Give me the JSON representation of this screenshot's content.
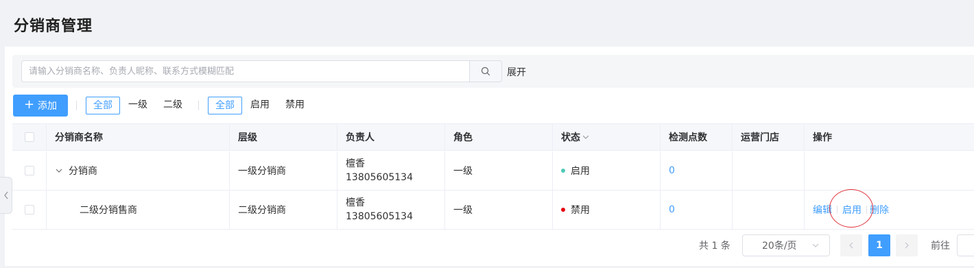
{
  "page": {
    "title": "分销商管理"
  },
  "search": {
    "placeholder": "请输入分销商名称、负责人昵称、联系方式模糊匹配",
    "value": "",
    "expand_label": "展开",
    "icon": "search-icon"
  },
  "toolbar": {
    "add_label": "添加",
    "level_filters": [
      "全部",
      "一级",
      "二级"
    ],
    "level_active": "全部",
    "status_filters": [
      "全部",
      "启用",
      "禁用"
    ],
    "status_active": "全部"
  },
  "table": {
    "columns": [
      "",
      "分销商名称",
      "层级",
      "负责人",
      "角色",
      "状态",
      "检测点数",
      "运营门店",
      "操作"
    ],
    "rows": [
      {
        "name": "分销商",
        "expandable": true,
        "level": "一级分销商",
        "owner_name": "檀香",
        "owner_phone": "13805605134",
        "role": "一级",
        "status": "启用",
        "status_color": "#4fc9b5",
        "points": "0",
        "stores": "",
        "actions": []
      },
      {
        "name": "二级分销售商",
        "expandable": false,
        "level": "二级分销商",
        "owner_name": "檀香",
        "owner_phone": "13805605134",
        "role": "一级",
        "status": "禁用",
        "status_color": "#e6000f",
        "points": "0",
        "stores": "",
        "actions": [
          "编辑",
          "启用",
          "删除"
        ]
      }
    ]
  },
  "pagination": {
    "total_text": "共 1 条",
    "page_size": "20条/页",
    "current_page": "1",
    "goto_label": "前往"
  },
  "colors": {
    "primary": "#409eff",
    "annotation": "#e0323b"
  }
}
